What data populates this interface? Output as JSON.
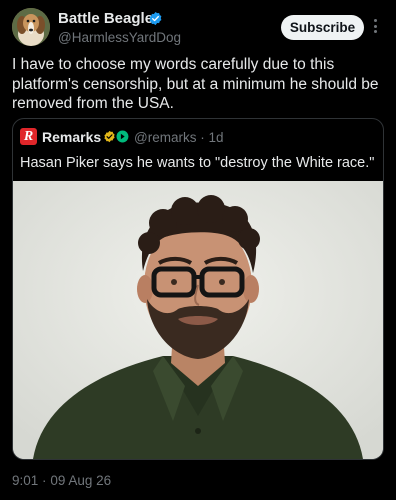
{
  "post": {
    "author_name": "Battle Beagle",
    "author_handle": "@HarmlessYardDog",
    "subscribe_label": "Subscribe",
    "text": "I have to choose my words carefully due to this platform's censorship, but at a minimum he should be removed from the USA.",
    "time": "9:01",
    "separator": "·",
    "date": "09 Aug 26"
  },
  "quote": {
    "logo_letter": "R",
    "author_name": "Remarks",
    "author_handle": "@remarks",
    "separator": "·",
    "age": "1d",
    "text": "Hasan Piker says he wants to \"destroy the White race.\""
  },
  "icons": {
    "verified": "verified-badge-icon",
    "more": "more-options-icon",
    "gold_badge": "gold-badge-icon",
    "green_badge": "green-badge-icon"
  },
  "colors": {
    "background": "#000000",
    "text": "#e7e9ea",
    "muted": "#71767b",
    "verified_blue": "#1d9bf0",
    "subscribe_bg": "#eff3f4",
    "remarks_red": "#e0262a",
    "gold": "#e2b719",
    "green": "#00ba7c"
  }
}
